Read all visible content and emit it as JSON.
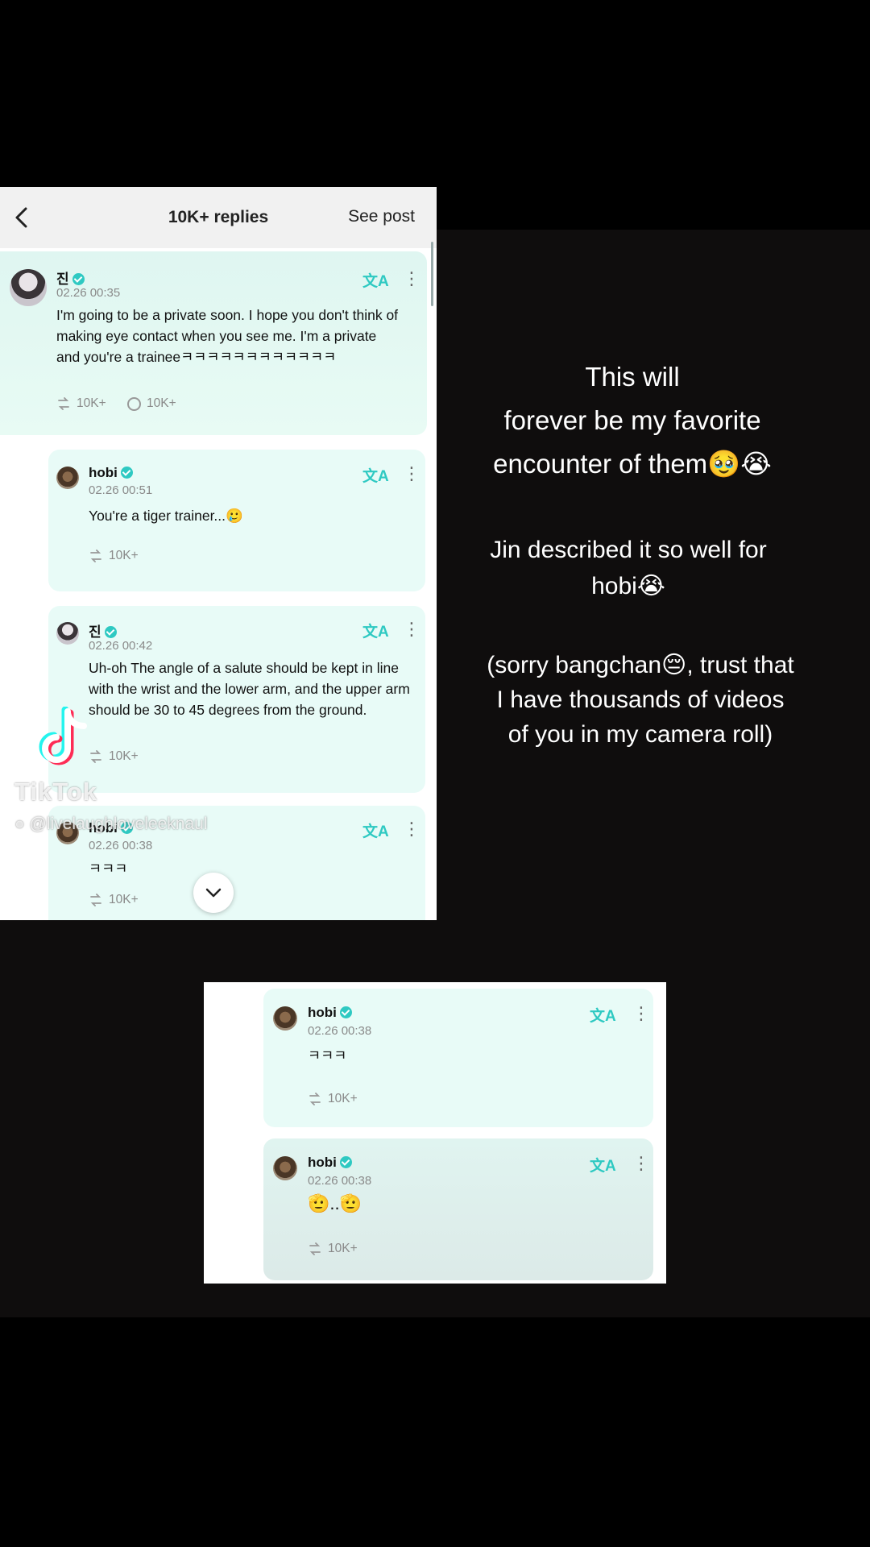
{
  "header": {
    "title": "10K+ replies",
    "see_post": "See post"
  },
  "comments": [
    {
      "name": "진",
      "time": "02.26 00:35",
      "text": "I'm going to be a private soon. I hope you don't think of making eye contact when you see me. I'm a private and you're a traineeㅋㅋㅋㅋㅋㅋㅋㅋㅋㅋㅋㅋ",
      "likes": "10K+",
      "replies": "10K+"
    },
    {
      "name": "hobi",
      "time": "02.26 00:51",
      "text": "You're a tiger trainer...🥲",
      "likes": "10K+"
    },
    {
      "name": "진",
      "time": "02.26 00:42",
      "text": "Uh-oh The angle of a salute should be kept in line with the wrist and the lower arm, and the upper arm should be 30 to 45 degrees from the ground.",
      "likes": "10K+"
    },
    {
      "name": "hobi",
      "time": "02.26 00:38",
      "text": "ㅋㅋㅋ",
      "likes": "10K+"
    }
  ],
  "second_comments": [
    {
      "name": "hobi",
      "time": "02.26 00:38",
      "text": "ㅋㅋㅋ",
      "likes": "10K+"
    },
    {
      "name": "hobi",
      "time": "02.26 00:38",
      "text": "🫡..🫡",
      "likes": "10K+"
    }
  ],
  "icons": {
    "translate": "文A",
    "more": "⋮"
  },
  "watermark": {
    "brand": "TikTok",
    "handle": "@livelaughloveleeknaul"
  },
  "caption": {
    "line1": "This will",
    "line2": "forever be my favorite",
    "line3": "encounter of them🥹😭",
    "line4": "Jin described it so well for",
    "line5": "hobi😭",
    "line6": "(sorry bangchan😔, trust that",
    "line7": "I have thousands of videos",
    "line8": "of you in my camera roll)"
  },
  "colors": {
    "accent": "#2ec9c2",
    "card": "#e8fbf7",
    "background": "#000000",
    "band": "#0f0d0d"
  }
}
